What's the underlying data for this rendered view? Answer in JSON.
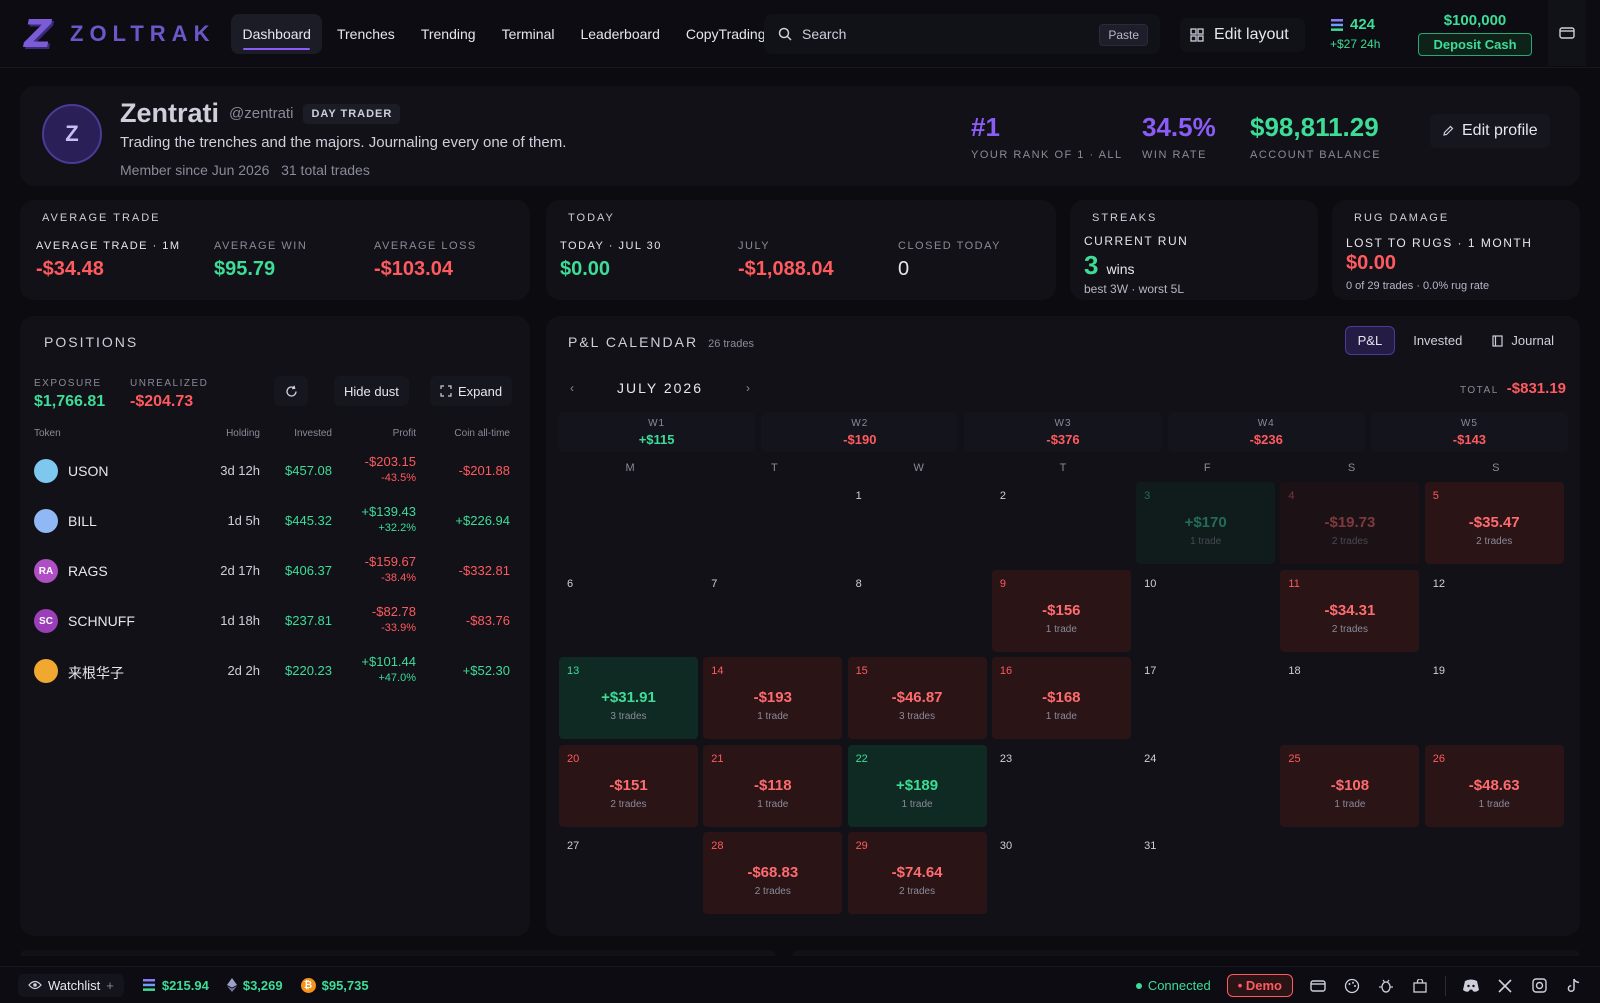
{
  "nav": {
    "brand": "ZOLTRAK",
    "links": [
      "Dashboard",
      "Trenches",
      "Trending",
      "Terminal",
      "Leaderboard",
      "CopyTrading"
    ],
    "active": "Dashboard",
    "search_placeholder": "Search",
    "paste_label": "Paste",
    "edit_layout_label": "Edit layout",
    "sol_balance": "424",
    "sol_change": "+$27 24h",
    "cash_balance": "$100,000",
    "deposit_label": "Deposit Cash"
  },
  "profile": {
    "avatar_initial": "Z",
    "name": "Zentrati",
    "handle": "@zentrati",
    "tag": "DAY TRADER",
    "bio": "Trading the trenches and the majors. Journaling every one of them.",
    "member_since": "Member since Jun 2026",
    "total_trades": "31 total trades",
    "rank_value": "#1",
    "rank_label": "YOUR RANK OF 1 · ALL",
    "winrate_value": "34.5%",
    "winrate_label": "WIN RATE",
    "balance_value": "$98,811.29",
    "balance_label": "ACCOUNT BALANCE",
    "edit_label": "Edit profile"
  },
  "average_trade": {
    "title": "AVERAGE TRADE",
    "c1_label": "AVERAGE TRADE · 1M",
    "c1_value": "-$34.48",
    "c2_label": "AVERAGE WIN",
    "c2_value": "$95.79",
    "c3_label": "AVERAGE LOSS",
    "c3_value": "-$103.04"
  },
  "today": {
    "title": "TODAY",
    "c1_label": "TODAY · JUL 30",
    "c1_value": "$0.00",
    "c2_label": "JULY",
    "c2_value": "-$1,088.04",
    "c3_label": "CLOSED TODAY",
    "c3_value": "0"
  },
  "streaks": {
    "title": "STREAKS",
    "label": "CURRENT RUN",
    "count": "3",
    "unit": "wins",
    "sub": "best 3W · worst 5L"
  },
  "rug": {
    "title": "RUG DAMAGE",
    "label": "LOST TO RUGS · 1 MONTH",
    "value": "$0.00",
    "sub": "0 of 29 trades · 0.0% rug rate"
  },
  "positions": {
    "title": "POSITIONS",
    "exposure_label": "EXPOSURE",
    "exposure_value": "$1,766.81",
    "unrealized_label": "UNREALIZED",
    "unrealized_value": "-$204.73",
    "hide_dust_label": "Hide dust",
    "expand_label": "Expand",
    "headers": [
      "Token",
      "Holding",
      "Invested",
      "Profit",
      "Coin all-time"
    ],
    "rows": [
      {
        "token": "USON",
        "holding": "3d 12h",
        "invested": "$457.08",
        "profit": "-$203.15",
        "pct": "-43.5%",
        "alltime": "-$201.88",
        "color": "#7ec8f0",
        "init": ""
      },
      {
        "token": "BILL",
        "holding": "1d 5h",
        "invested": "$445.32",
        "profit": "+$139.43",
        "pct": "+32.2%",
        "alltime": "+$226.94",
        "color": "#8fb8f5",
        "init": ""
      },
      {
        "token": "RAGS",
        "holding": "2d 17h",
        "invested": "$406.37",
        "profit": "-$159.67",
        "pct": "-38.4%",
        "alltime": "-$332.81",
        "color": "#b04fc4",
        "init": "RA"
      },
      {
        "token": "SCHNUFF",
        "holding": "1d 18h",
        "invested": "$237.81",
        "profit": "-$82.78",
        "pct": "-33.9%",
        "alltime": "-$83.76",
        "color": "#9a3fb8",
        "init": "SC"
      },
      {
        "token": "来根华子",
        "holding": "2d 2h",
        "invested": "$220.23",
        "profit": "+$101.44",
        "pct": "+47.0%",
        "alltime": "+$52.30",
        "color": "#f0a830",
        "init": ""
      }
    ]
  },
  "calendar": {
    "title": "P&L CALENDAR",
    "trades": "26 trades",
    "tabs": [
      "P&L",
      "Invested",
      "Journal"
    ],
    "month": "JULY 2026",
    "total_label": "TOTAL",
    "total_value": "-$831.19",
    "weeks": [
      {
        "label": "W1",
        "value": "+$115",
        "sign": "pos"
      },
      {
        "label": "W2",
        "value": "-$190",
        "sign": "neg"
      },
      {
        "label": "W3",
        "value": "-$376",
        "sign": "neg"
      },
      {
        "label": "W4",
        "value": "-$236",
        "sign": "neg"
      },
      {
        "label": "W5",
        "value": "-$143",
        "sign": "neg"
      }
    ],
    "dow": [
      "M",
      "T",
      "W",
      "T",
      "F",
      "S",
      "S"
    ],
    "first_weekday": 2,
    "days": [
      {
        "d": "1"
      },
      {
        "d": "2"
      },
      {
        "d": "3",
        "amt": "+$170",
        "cnt": "1 trade",
        "sign": "pos",
        "faded": true
      },
      {
        "d": "4",
        "amt": "-$19.73",
        "cnt": "2 trades",
        "sign": "neg",
        "faded": true
      },
      {
        "d": "5",
        "amt": "-$35.47",
        "cnt": "2 trades",
        "sign": "neg"
      },
      {
        "d": "6"
      },
      {
        "d": "7"
      },
      {
        "d": "8"
      },
      {
        "d": "9",
        "amt": "-$156",
        "cnt": "1 trade",
        "sign": "neg"
      },
      {
        "d": "10"
      },
      {
        "d": "11",
        "amt": "-$34.31",
        "cnt": "2 trades",
        "sign": "neg"
      },
      {
        "d": "12"
      },
      {
        "d": "13",
        "amt": "+$31.91",
        "cnt": "3 trades",
        "sign": "pos"
      },
      {
        "d": "14",
        "amt": "-$193",
        "cnt": "1 trade",
        "sign": "neg"
      },
      {
        "d": "15",
        "amt": "-$46.87",
        "cnt": "3 trades",
        "sign": "neg"
      },
      {
        "d": "16",
        "amt": "-$168",
        "cnt": "1 trade",
        "sign": "neg"
      },
      {
        "d": "17"
      },
      {
        "d": "18"
      },
      {
        "d": "19"
      },
      {
        "d": "20",
        "amt": "-$151",
        "cnt": "2 trades",
        "sign": "neg"
      },
      {
        "d": "21",
        "amt": "-$118",
        "cnt": "1 trade",
        "sign": "neg"
      },
      {
        "d": "22",
        "amt": "+$189",
        "cnt": "1 trade",
        "sign": "pos"
      },
      {
        "d": "23"
      },
      {
        "d": "24"
      },
      {
        "d": "25",
        "amt": "-$108",
        "cnt": "1 trade",
        "sign": "neg"
      },
      {
        "d": "26",
        "amt": "-$48.63",
        "cnt": "1 trade",
        "sign": "neg"
      },
      {
        "d": "27"
      },
      {
        "d": "28",
        "amt": "-$68.83",
        "cnt": "2 trades",
        "sign": "neg"
      },
      {
        "d": "29",
        "amt": "-$74.64",
        "cnt": "2 trades",
        "sign": "neg"
      },
      {
        "d": "30"
      },
      {
        "d": "31"
      }
    ]
  },
  "footer": {
    "watchlist_label": "Watchlist",
    "sol_price": "$215.94",
    "eth_price": "$3,269",
    "btc_price": "$95,735",
    "connected_label": "Connected",
    "demo_label": "Demo"
  },
  "colors": {
    "green": "#3ddc97",
    "red": "#ff5a5f",
    "purple": "#8b5cf6"
  }
}
